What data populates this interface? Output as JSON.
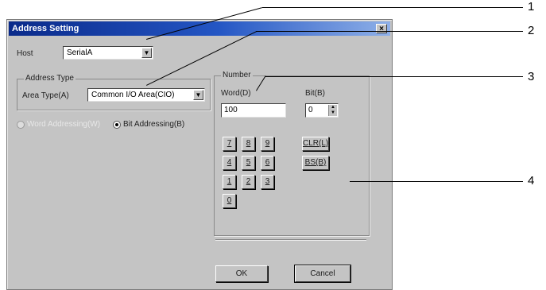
{
  "dialog": {
    "title": "Address Setting",
    "close_label": "×",
    "host": {
      "label": "Host",
      "value": "SerialA"
    },
    "address_type": {
      "group_label": "Address Type",
      "area_type_label": "Area Type(A)",
      "area_type_value": "Common I/O Area(CIO)"
    },
    "addressing": {
      "word_label": "Word Addressing(W)",
      "bit_label": "Bit Addressing(B)",
      "selected": "bit"
    },
    "number": {
      "group_label": "Number",
      "word_label": "Word(D)",
      "word_value": "100",
      "bit_label": "Bit(B)",
      "bit_value": "0"
    },
    "keypad": {
      "keys": [
        "7",
        "8",
        "9",
        "4",
        "5",
        "6",
        "1",
        "2",
        "3",
        "0"
      ],
      "clr_label": "CLR(L)",
      "bs_label": "BS(B)"
    },
    "ok_label": "OK",
    "cancel_label": "Cancel"
  },
  "callouts": [
    "1",
    "2",
    "3",
    "4"
  ]
}
